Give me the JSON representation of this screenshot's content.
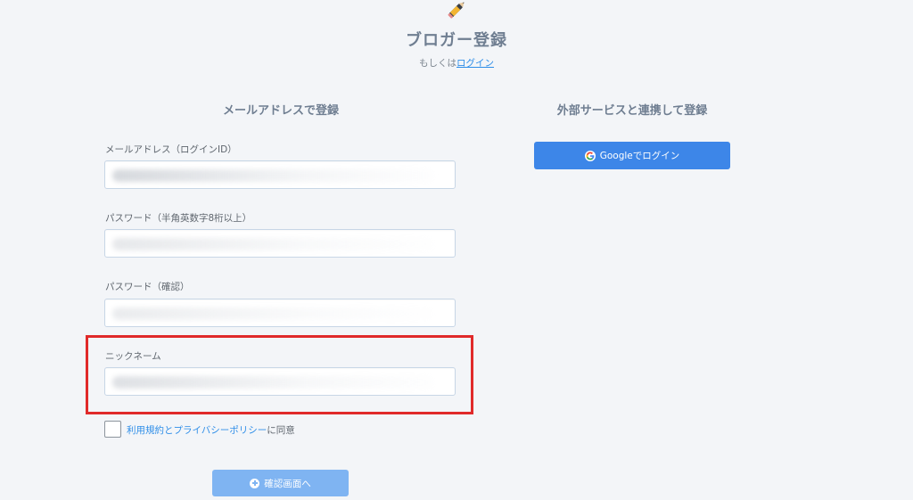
{
  "header": {
    "icon": "pencil-icon",
    "title": "ブロガー登録",
    "or_text": "もしくは",
    "login_link": "ログイン"
  },
  "email_section": {
    "title": "メールアドレスで登録",
    "fields": [
      {
        "label": "メールアドレス（ログインID）",
        "value": ""
      },
      {
        "label": "パスワード（半角英数字8桁以上）",
        "value": ""
      },
      {
        "label": "パスワード（確認）",
        "value": ""
      },
      {
        "label": "ニックネーム",
        "value": ""
      }
    ],
    "terms_link": "利用規約とプライバシーポリシー",
    "terms_suffix": "に同意",
    "confirm_button": "確認画面へ"
  },
  "external_section": {
    "title": "外部サービスと連携して登録",
    "google_button": "Googleでログイン"
  },
  "colors": {
    "accent": "#3d86e8",
    "confirm_button": "#7fb4f2",
    "highlight_box": "#e02a2a",
    "background": "#f3f5f8"
  }
}
